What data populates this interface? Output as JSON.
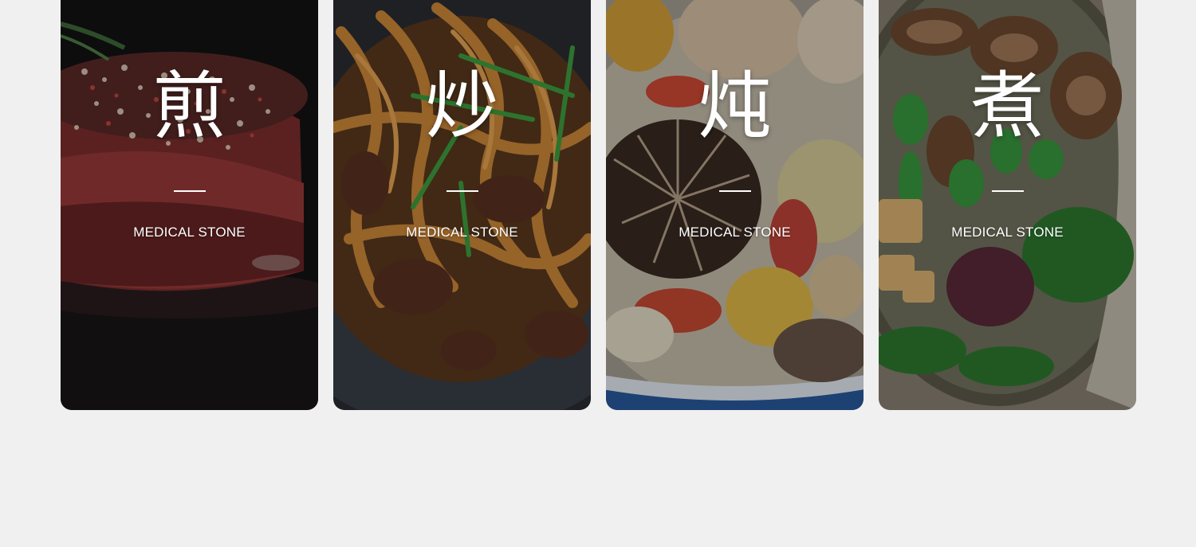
{
  "cards": [
    {
      "glyph": "煎",
      "subtitle": "MEDICAL STONE",
      "image": "seared-steak"
    },
    {
      "glyph": "炒",
      "subtitle": "MEDICAL STONE",
      "image": "stir-fried-noodles"
    },
    {
      "glyph": "炖",
      "subtitle": "MEDICAL STONE",
      "image": "stew-with-mushrooms"
    },
    {
      "glyph": "煮",
      "subtitle": "MEDICAL STONE",
      "image": "boiled-soup-with-greens"
    }
  ]
}
